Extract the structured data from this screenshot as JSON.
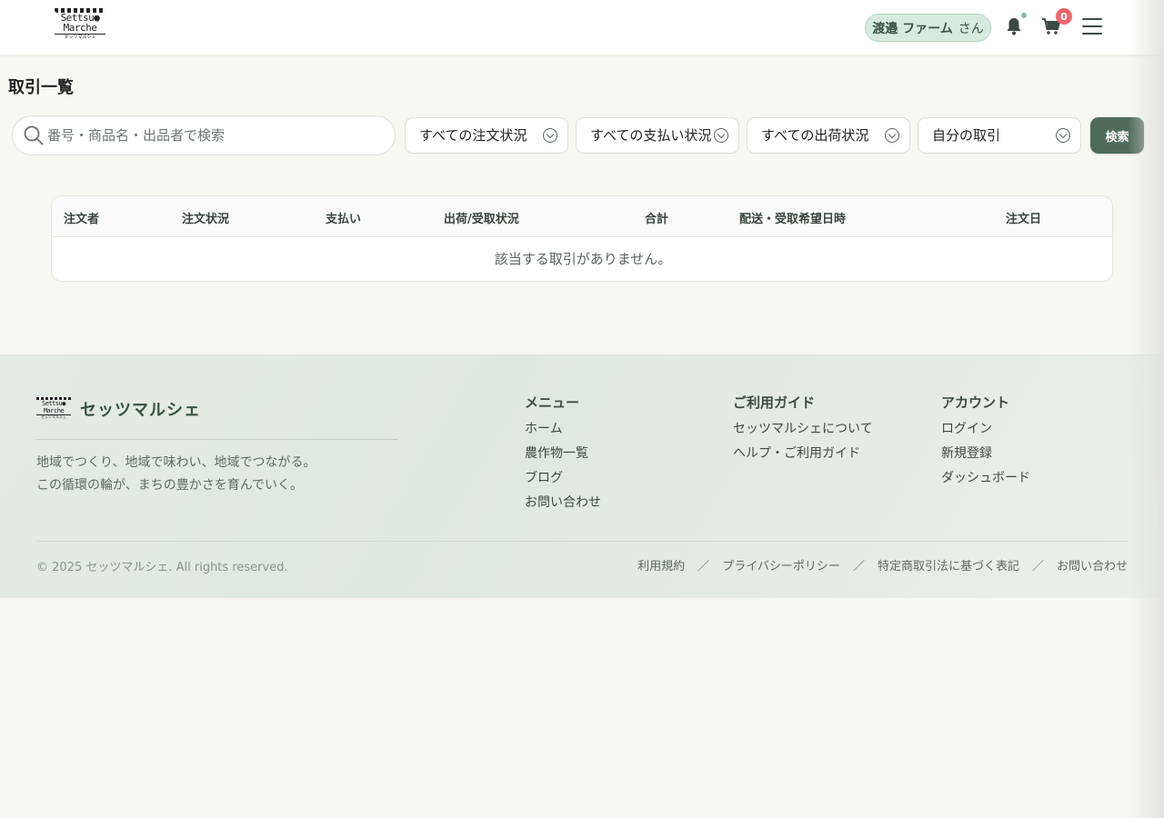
{
  "header": {
    "logo": {
      "line1": "Settsu●",
      "line2": "Marche",
      "line3": "セッツマルシェ"
    },
    "user_name": "渡邉 ファーム",
    "user_suffix": "さん",
    "cart_count": "0"
  },
  "page": {
    "title": "取引一覧"
  },
  "filters": {
    "search_placeholder": "番号・商品名・出品者で検索",
    "order_status": "すべての注文状況",
    "payment_status": "すべての支払い状況",
    "shipping_status": "すべての出荷状況",
    "scope": "自分の取引",
    "search_button": "検索"
  },
  "table": {
    "columns": [
      "注文者",
      "注文状況",
      "支払い",
      "出荷/受取状況",
      "合計",
      "配送・受取希望日時",
      "注文日"
    ],
    "empty_message": "該当する取引がありません。"
  },
  "footer": {
    "brand": "セッツマルシェ",
    "tagline_1": "地域でつくり、地域で味わい、地域でつながる。",
    "tagline_2": "この循環の輪が、まちの豊かさを育んでいく。",
    "menu": {
      "heading": "メニュー",
      "items": [
        "ホーム",
        "農作物一覧",
        "ブログ",
        "お問い合わせ"
      ]
    },
    "guide": {
      "heading": "ご利用ガイド",
      "items": [
        "セッツマルシェについて",
        "ヘルプ・ご利用ガイド"
      ]
    },
    "account": {
      "heading": "アカウント",
      "items": [
        "ログイン",
        "新規登録",
        "ダッシュボード"
      ]
    },
    "copyright": "© 2025 セッツマルシェ. All rights reserved.",
    "legal_links": [
      "利用規約",
      "プライバシーポリシー",
      "特定商取引法に基づく表記",
      "お問い合わせ"
    ],
    "separator": "／"
  },
  "colors": {
    "accent": "#4e6b5a",
    "badge": "#f2646c",
    "chip_bg": "#d6eadd"
  }
}
